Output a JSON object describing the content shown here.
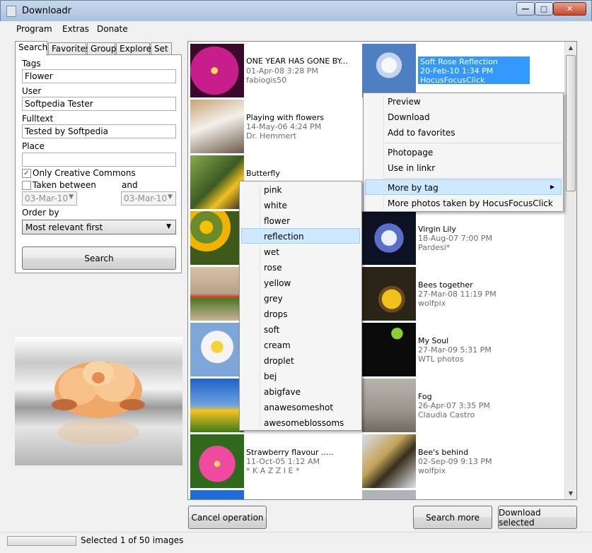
{
  "window": {
    "title": "Downloadr"
  },
  "menu": [
    "Program",
    "Extras",
    "Donate"
  ],
  "tabs": [
    "Search",
    "Favorites",
    "Group",
    "Explore",
    "Set"
  ],
  "search": {
    "tags_label": "Tags",
    "tags_value": "Flower",
    "user_label": "User",
    "user_value": "Softpedia Tester",
    "fulltext_label": "Fulltext",
    "fulltext_value": "Tested by Softpedia",
    "place_label": "Place",
    "place_value": "",
    "cc_label": "Only Creative Commons",
    "cc_checked": true,
    "taken_label": "Taken between",
    "and_label": "and",
    "date_from": "03-Mar-10",
    "date_to": "03-Mar-10",
    "order_label": "Order by",
    "order_value": "Most relevant first",
    "search_button": "Search"
  },
  "items": [
    {
      "title": "ONE YEAR HAS GONE BY...",
      "date": "01-Apr-08 3:28 PM",
      "author": "fabiogis50"
    },
    {
      "title": "Soft Rose Reflection",
      "date": "20-Feb-10 1:34 PM",
      "author": "HocusFocusClick"
    },
    {
      "title": "Playing with flowers",
      "date": "14-May-06 4:24 PM",
      "author": "Dr. Hemmert"
    },
    {
      "title": "Butterfly",
      "date": "",
      "author": ""
    },
    {
      "title": "Virgin Lily",
      "date": "18-Aug-07 7:00 PM",
      "author": "Pardesi*"
    },
    {
      "title": "Bees together",
      "date": "27-Mar-08 11:19 PM",
      "author": "wolfpix"
    },
    {
      "title": "My Soul",
      "date": "27-Mar-09 5:31 PM",
      "author": "WTL photos"
    },
    {
      "title": "Fog",
      "date": "26-Apr-07 3:35 PM",
      "author": "Claudia Castro"
    },
    {
      "title": "Strawberry flavour .....",
      "date": "11-Oct-05 1:12 AM",
      "author": "* K A Z Z I E *"
    },
    {
      "title": "Bee's behind",
      "date": "02-Sep-09 9:13 PM",
      "author": "wolfpix"
    }
  ],
  "context_menu": {
    "items": [
      "Preview",
      "Download",
      "Add to favorites",
      "Photopage",
      "Use in linkr",
      "More by tag",
      "More photos taken by HocusFocusClick"
    ],
    "highlighted": "More by tag"
  },
  "submenu": {
    "items": [
      "pink",
      "white",
      "flower",
      "reflection",
      "wet",
      "rose",
      "yellow",
      "grey",
      "drops",
      "soft",
      "cream",
      "droplet",
      "bej",
      "abigfave",
      "anawesomeshot",
      "awesomeblossoms"
    ],
    "highlighted": "reflection"
  },
  "buttons": {
    "cancel": "Cancel operation",
    "search_more": "Search more",
    "download_selected": "Download selected"
  },
  "status": {
    "text": "Selected 1 of 50 images",
    "progress": 0
  },
  "colors": {
    "selection": "#3399ff",
    "menu_highlight": "#cde8ff",
    "secondary_text": "#6d6d6d"
  }
}
